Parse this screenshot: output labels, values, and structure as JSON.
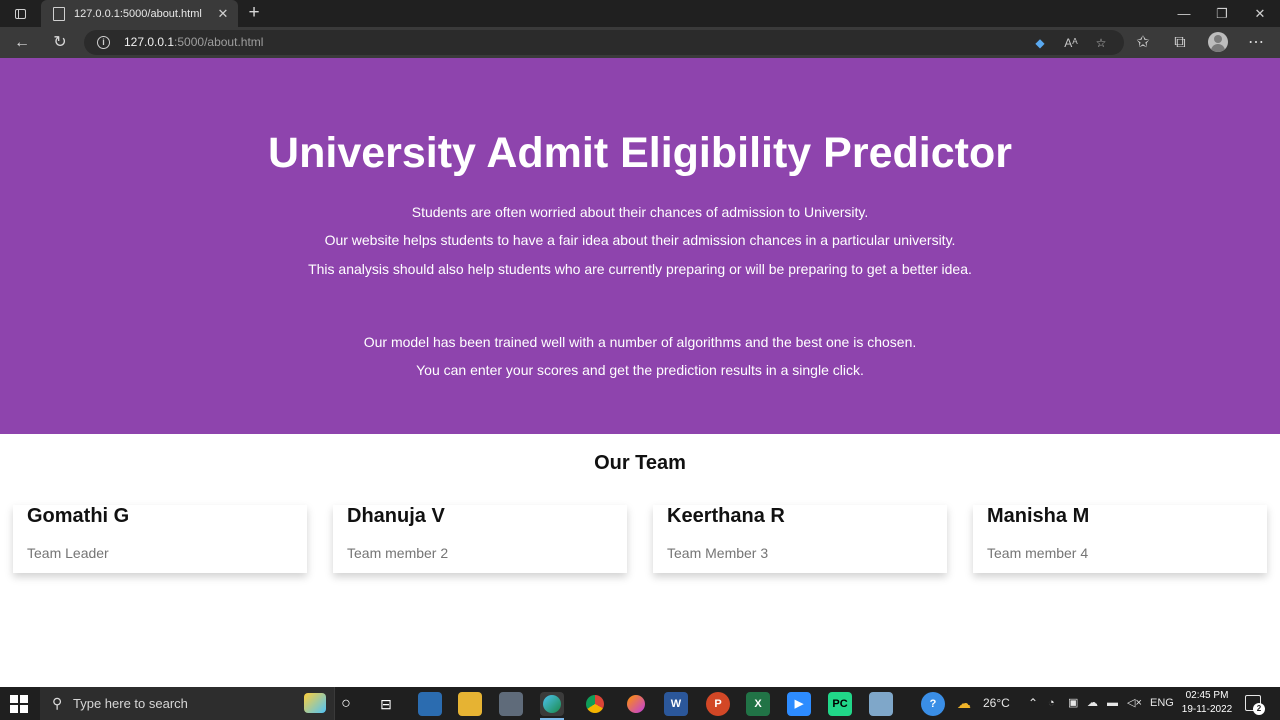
{
  "browser": {
    "tab_title": "127.0.0.1:5000/about.html",
    "url_host": "127.0.0.1",
    "url_path": ":5000/about.html"
  },
  "hero": {
    "title": "University Admit Eligibility Predictor",
    "lines": [
      "Students are often worried about their chances of admission to University.",
      "Our website helps students to have a fair idea about their admission chances in a particular university.",
      "This analysis should also help students who are currently preparing or will be preparing to get a better idea.",
      "Our model has been trained well with a number of algorithms and the best one is chosen.",
      "You can enter your scores and get the prediction results in a single click."
    ],
    "background_color": "#8e44ad"
  },
  "team": {
    "heading": "Our Team",
    "members": [
      {
        "name": "Gomathi G",
        "role": "Team Leader"
      },
      {
        "name": "Dhanuja V",
        "role": "Team member 2"
      },
      {
        "name": "Keerthana R",
        "role": "Team Member 3"
      },
      {
        "name": "Manisha M",
        "role": "Team member 4"
      }
    ]
  },
  "taskbar": {
    "search_placeholder": "Type here to search",
    "weather": "26°C",
    "language": "ENG",
    "time": "02:45 PM",
    "date": "19-11-2022",
    "notification_count": "2"
  }
}
